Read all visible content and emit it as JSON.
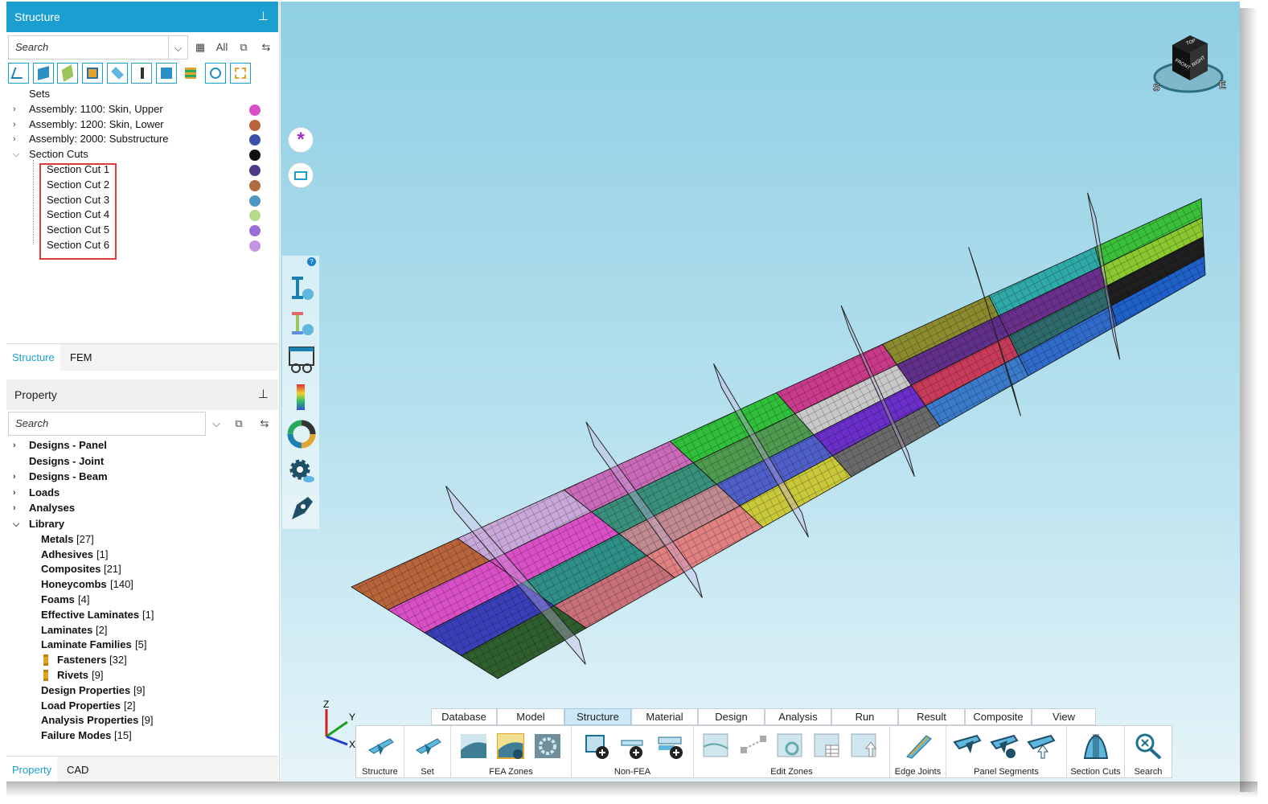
{
  "structure_panel": {
    "title": "Structure",
    "search_placeholder": "Search",
    "all_label": "All",
    "tree": [
      {
        "label": "Sets",
        "expandable": false
      },
      {
        "label": "Assembly: 1100: Skin, Upper",
        "expandable": true,
        "color": "#d94fc6"
      },
      {
        "label": "Assembly: 1200: Skin, Lower",
        "expandable": true,
        "color": "#b8643a"
      },
      {
        "label": "Assembly: 2000: Substructure",
        "expandable": true,
        "color": "#3b4fa8"
      },
      {
        "label": "Section Cuts",
        "expandable": true,
        "expanded": true,
        "color": "#111111"
      }
    ],
    "section_cuts": [
      {
        "label": "Section Cut 1",
        "color": "#4e3a86"
      },
      {
        "label": "Section Cut 2",
        "color": "#b26b3e"
      },
      {
        "label": "Section Cut 3",
        "color": "#4f98c6"
      },
      {
        "label": "Section Cut 4",
        "color": "#b7d98a"
      },
      {
        "label": "Section Cut 5",
        "color": "#9a6fd6"
      },
      {
        "label": "Section Cut 6",
        "color": "#c594e0"
      }
    ],
    "tabs": [
      "Structure",
      "FEM"
    ]
  },
  "property_panel": {
    "title": "Property",
    "search_placeholder": "Search",
    "tree": [
      {
        "label": "Designs - Panel",
        "expandable": true
      },
      {
        "label": "Designs - Joint",
        "expandable": false
      },
      {
        "label": "Designs - Beam",
        "expandable": true
      },
      {
        "label": "Loads",
        "expandable": true
      },
      {
        "label": "Analyses",
        "expandable": true
      },
      {
        "label": "Library",
        "expandable": true,
        "expanded": true
      }
    ],
    "library": [
      {
        "name": "Metals",
        "count": "[27]"
      },
      {
        "name": "Adhesives",
        "count": "[1]"
      },
      {
        "name": "Composites",
        "count": "[21]"
      },
      {
        "name": "Honeycombs",
        "count": "[140]"
      },
      {
        "name": "Foams",
        "count": "[4]"
      },
      {
        "name": "Effective Laminates",
        "count": "[1]"
      },
      {
        "name": "Laminates",
        "count": "[2]"
      },
      {
        "name": "Laminate Families",
        "count": "[5]"
      },
      {
        "name": "Fasteners",
        "count": "[32]",
        "icon": true
      },
      {
        "name": "Rivets",
        "count": "[9]",
        "icon": true
      },
      {
        "name": "Design Properties",
        "count": "[9]"
      },
      {
        "name": "Load Properties",
        "count": "[2]"
      },
      {
        "name": "Analysis Properties",
        "count": "[9]"
      },
      {
        "name": "Failure Modes",
        "count": "[15]"
      }
    ],
    "tabs": [
      "Property",
      "CAD"
    ]
  },
  "ribbon": {
    "tabs": [
      "Database",
      "Model",
      "Structure",
      "Material",
      "Design",
      "Analysis",
      "Run",
      "Result",
      "Composite",
      "View"
    ],
    "active_tab": "Structure",
    "groups": [
      "Structure",
      "Set",
      "FEA Zones",
      "Non-FEA",
      "Edit Zones",
      "Edge Joints",
      "Panel Segments",
      "Section Cuts",
      "Search"
    ]
  },
  "viewport": {
    "axes": {
      "z": "Z",
      "y": "Y",
      "x": "X"
    },
    "view_cube": {
      "top": "TOP",
      "front": "FRONT",
      "right": "RIGHT",
      "s": "S",
      "e": "E"
    },
    "help_badge": "?"
  }
}
